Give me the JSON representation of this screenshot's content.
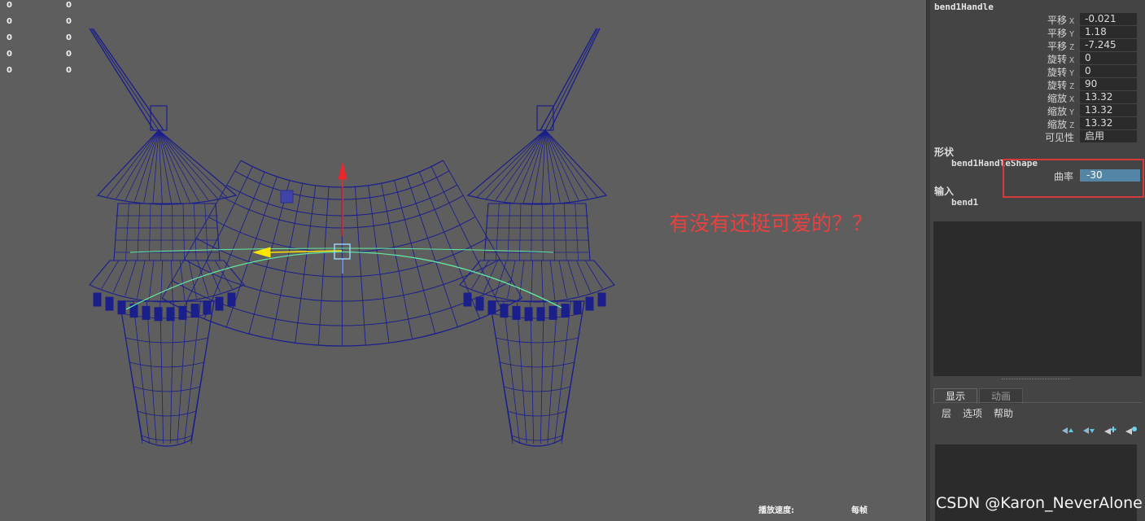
{
  "viewport": {
    "hud_rows": [
      [
        "0",
        "0"
      ],
      [
        "0",
        "0"
      ],
      [
        "0",
        "0"
      ],
      [
        "0",
        "0"
      ],
      [
        "0",
        "0"
      ]
    ],
    "annotation": "有没有还挺可爱的？？",
    "playback_label": "播放速度:",
    "playback_value": "每帧",
    "watermark": "CSDN @Karon_NeverAlone",
    "wire_color": "#1b1f8a",
    "bend_curve_color": "#61e8a3",
    "manip_color": "#ffe600",
    "axis_color": "#e8282d",
    "handle_color": "#9ad8ff"
  },
  "channel_box": {
    "node": "bend1Handle",
    "attributes": [
      {
        "label": "平移",
        "axis": "X",
        "value": "-0.021"
      },
      {
        "label": "平移",
        "axis": "Y",
        "value": "1.18"
      },
      {
        "label": "平移",
        "axis": "Z",
        "value": "-7.245"
      },
      {
        "label": "旋转",
        "axis": "X",
        "value": "0"
      },
      {
        "label": "旋转",
        "axis": "Y",
        "value": "0"
      },
      {
        "label": "旋转",
        "axis": "Z",
        "value": "90"
      },
      {
        "label": "缩放",
        "axis": "X",
        "value": "13.32"
      },
      {
        "label": "缩放",
        "axis": "Y",
        "value": "13.32"
      },
      {
        "label": "缩放",
        "axis": "Z",
        "value": "13.32"
      },
      {
        "label": "可见性",
        "axis": "",
        "value": "启用"
      }
    ],
    "shapes_label": "形状",
    "shape_node": "bend1HandleShape",
    "curvature_label": "曲率",
    "curvature_value": "-30",
    "inputs_label": "输入",
    "input_node": "bend1"
  },
  "layer_editor": {
    "tabs": [
      "显示",
      "动画"
    ],
    "menu": [
      "层",
      "选项",
      "帮助"
    ],
    "icons": [
      "move-layer-up-icon",
      "move-layer-down-icon",
      "new-layer-selected-icon",
      "new-layer-icon"
    ]
  }
}
